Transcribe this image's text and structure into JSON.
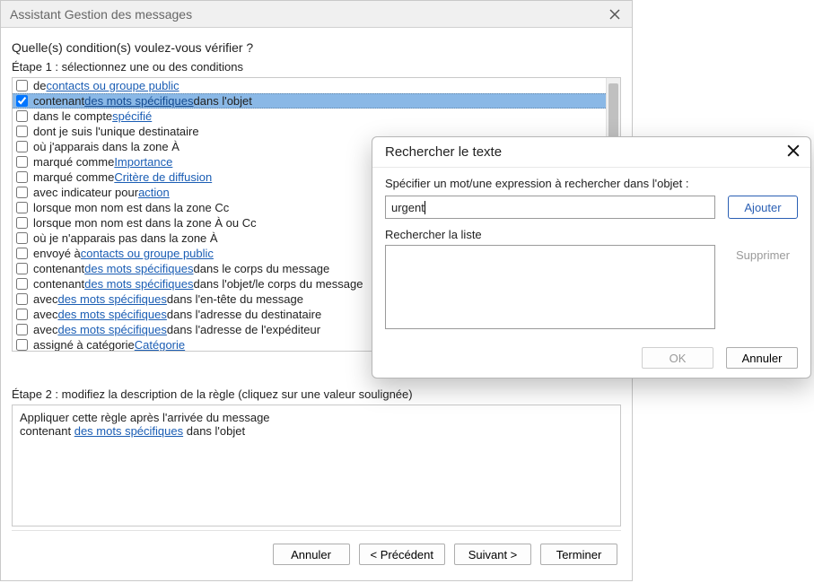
{
  "wizard": {
    "title": "Assistant Gestion des messages",
    "question": "Quelle(s) condition(s) voulez-vous vérifier ?",
    "step1_label": "Étape 1 : sélectionnez une ou des conditions",
    "step2_label": "Étape 2 : modifiez la description de la règle (cliquez sur une valeur soulignée)",
    "buttons": {
      "cancel": "Annuler",
      "back": "<  Précédent",
      "next": "Suivant  >",
      "finish": "Terminer"
    },
    "description": {
      "line1": "Appliquer cette règle après l'arrivée du message",
      "line2_prefix": "contenant ",
      "line2_link": "des mots spécifiques",
      "line2_suffix": " dans l'objet"
    }
  },
  "conditions": [
    {
      "checked": false,
      "parts": [
        {
          "t": "de "
        },
        {
          "t": "contacts ou groupe public",
          "link": true
        }
      ]
    },
    {
      "checked": true,
      "selected": true,
      "parts": [
        {
          "t": "contenant "
        },
        {
          "t": "des mots spécifiques",
          "link": true
        },
        {
          "t": " dans l'objet"
        }
      ]
    },
    {
      "checked": false,
      "parts": [
        {
          "t": "dans le compte "
        },
        {
          "t": "spécifié",
          "link": true
        }
      ]
    },
    {
      "checked": false,
      "parts": [
        {
          "t": "dont je suis l'unique destinataire"
        }
      ]
    },
    {
      "checked": false,
      "parts": [
        {
          "t": "où j'apparais dans la zone À"
        }
      ]
    },
    {
      "checked": false,
      "parts": [
        {
          "t": "marqué comme "
        },
        {
          "t": "Importance",
          "link": true
        }
      ]
    },
    {
      "checked": false,
      "parts": [
        {
          "t": "marqué comme "
        },
        {
          "t": "Critère de diffusion",
          "link": true
        }
      ]
    },
    {
      "checked": false,
      "parts": [
        {
          "t": "avec indicateur pour "
        },
        {
          "t": "action ",
          "link": true
        }
      ]
    },
    {
      "checked": false,
      "parts": [
        {
          "t": "lorsque mon nom est dans la zone Cc"
        }
      ]
    },
    {
      "checked": false,
      "parts": [
        {
          "t": "lorsque mon nom est dans la zone À ou Cc"
        }
      ]
    },
    {
      "checked": false,
      "parts": [
        {
          "t": "où je n'apparais pas dans la zone À"
        }
      ]
    },
    {
      "checked": false,
      "parts": [
        {
          "t": "envoyé à "
        },
        {
          "t": "contacts ou groupe public",
          "link": true
        }
      ]
    },
    {
      "checked": false,
      "parts": [
        {
          "t": "contenant "
        },
        {
          "t": "des mots spécifiques",
          "link": true
        },
        {
          "t": " dans le corps du message"
        }
      ]
    },
    {
      "checked": false,
      "parts": [
        {
          "t": "contenant "
        },
        {
          "t": "des mots spécifiques",
          "link": true
        },
        {
          "t": " dans l'objet/le corps du message"
        }
      ]
    },
    {
      "checked": false,
      "parts": [
        {
          "t": "avec "
        },
        {
          "t": "des mots spécifiques",
          "link": true
        },
        {
          "t": " dans l'en-tête du message"
        }
      ]
    },
    {
      "checked": false,
      "parts": [
        {
          "t": "avec "
        },
        {
          "t": "des mots spécifiques",
          "link": true
        },
        {
          "t": " dans l'adresse du destinataire"
        }
      ]
    },
    {
      "checked": false,
      "parts": [
        {
          "t": "avec "
        },
        {
          "t": "des mots spécifiques",
          "link": true
        },
        {
          "t": " dans l'adresse de l'expéditeur"
        }
      ]
    },
    {
      "checked": false,
      "parts": [
        {
          "t": "assigné à catégorie "
        },
        {
          "t": "Catégorie",
          "link": true
        }
      ]
    }
  ],
  "dialog": {
    "title": "Rechercher le texte",
    "specify_label": "Spécifier un mot/une expression à rechercher dans l'objet :",
    "input_value": "urgent",
    "add": "Ajouter",
    "list_label": "Rechercher la liste",
    "remove": "Supprimer",
    "ok": "OK",
    "cancel": "Annuler"
  }
}
